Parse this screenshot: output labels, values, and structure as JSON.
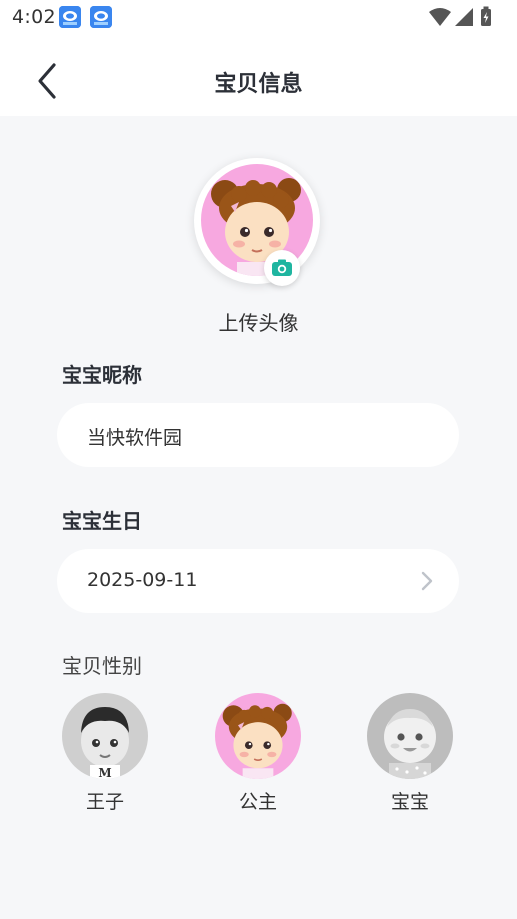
{
  "status_bar": {
    "time": "4:02"
  },
  "nav": {
    "title": "宝贝信息",
    "back_icon": "chevron-left-icon"
  },
  "avatar": {
    "upload_label": "上传头像",
    "camera_icon": "camera-icon"
  },
  "nickname": {
    "label": "宝宝昵称",
    "value": "当快软件园"
  },
  "birthday": {
    "label": "宝宝生日",
    "value": "2025-09-11"
  },
  "gender": {
    "label": "宝贝性别",
    "options": [
      {
        "label": "王子",
        "selected": false
      },
      {
        "label": "公主",
        "selected": true
      },
      {
        "label": "宝宝",
        "selected": false
      }
    ]
  },
  "colors": {
    "accent": "#1fb5a0",
    "girl_bg": "#f7a8e0"
  }
}
